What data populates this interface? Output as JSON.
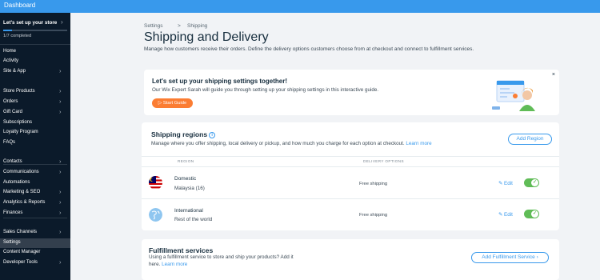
{
  "topbar": {
    "title": "Dashboard"
  },
  "sidebar": {
    "setup_title": "Let's set up your store",
    "setup_progress": "1/7 completed",
    "progress_fraction": 0.14,
    "items": [
      {
        "label": "Home",
        "chevron": false,
        "active": false
      },
      {
        "label": "Activity",
        "chevron": false,
        "active": false
      },
      {
        "label": "Site & App",
        "chevron": true,
        "active": false
      },
      {
        "label": "Store Products",
        "chevron": true,
        "active": false
      },
      {
        "label": "Orders",
        "chevron": true,
        "active": false
      },
      {
        "label": "Gift Card",
        "chevron": true,
        "active": false
      },
      {
        "label": "Subscriptions",
        "chevron": false,
        "active": false
      },
      {
        "label": "Loyalty Program",
        "chevron": false,
        "active": false
      },
      {
        "label": "FAQs",
        "chevron": false,
        "active": false
      },
      {
        "label": "Contacts",
        "chevron": true,
        "active": false
      },
      {
        "label": "Communications",
        "chevron": true,
        "active": false
      },
      {
        "label": "Automations",
        "chevron": false,
        "active": false
      },
      {
        "label": "Marketing & SEO",
        "chevron": true,
        "active": false
      },
      {
        "label": "Analytics & Reports",
        "chevron": true,
        "active": false
      },
      {
        "label": "Finances",
        "chevron": true,
        "active": false
      },
      {
        "label": "Sales Channels",
        "chevron": true,
        "active": false
      },
      {
        "label": "Settings",
        "chevron": false,
        "active": true
      },
      {
        "label": "Content Manager",
        "chevron": false,
        "active": false
      },
      {
        "label": "Developer Tools",
        "chevron": true,
        "active": false
      }
    ]
  },
  "breadcrumb": {
    "parent": "Settings",
    "separator": ">",
    "current": "Shipping"
  },
  "page": {
    "title": "Shipping and Delivery",
    "subtitle": "Manage how customers receive their orders. Define the delivery options customers choose from at checkout and connect to fulfillment services."
  },
  "guide": {
    "title": "Let's set up your shipping settings together!",
    "text": "Our Wix Expert Sarah will guide you through setting up your shipping settings in this interactive guide.",
    "button": "Start Guide",
    "close": "×"
  },
  "regions": {
    "title": "Shipping regions",
    "info": "i",
    "text": "Manage where you offer shipping, local delivery or pickup, and how much you charge for each option at checkout.",
    "learn_more": "Learn more",
    "add_button": "Add Region",
    "col_region": "REGION",
    "col_delivery": "DELIVERY OPTIONS",
    "rows": [
      {
        "name": "Domestic",
        "sub": "Malaysia (16)",
        "delivery": "Free shipping",
        "edit": "Edit",
        "enabled": true
      },
      {
        "name": "International",
        "sub": "Rest of the world",
        "delivery": "Free shipping",
        "edit": "Edit",
        "enabled": true
      }
    ]
  },
  "fulfillment": {
    "title": "Fulfillment services",
    "text_line1": "Using a fulfillment service to store and ship your products? Add it",
    "text_line2": "here.",
    "learn_more": "Learn more",
    "button": "Add Fulfillment Service"
  },
  "icons": {
    "chevron": "›",
    "pencil": "✎",
    "check": "✓",
    "play": "▷"
  },
  "colors": {
    "accent": "#3899ec",
    "orange": "#fb7d33",
    "toggle_on": "#60bc57",
    "sidebar_bg": "#0b1a2a"
  }
}
